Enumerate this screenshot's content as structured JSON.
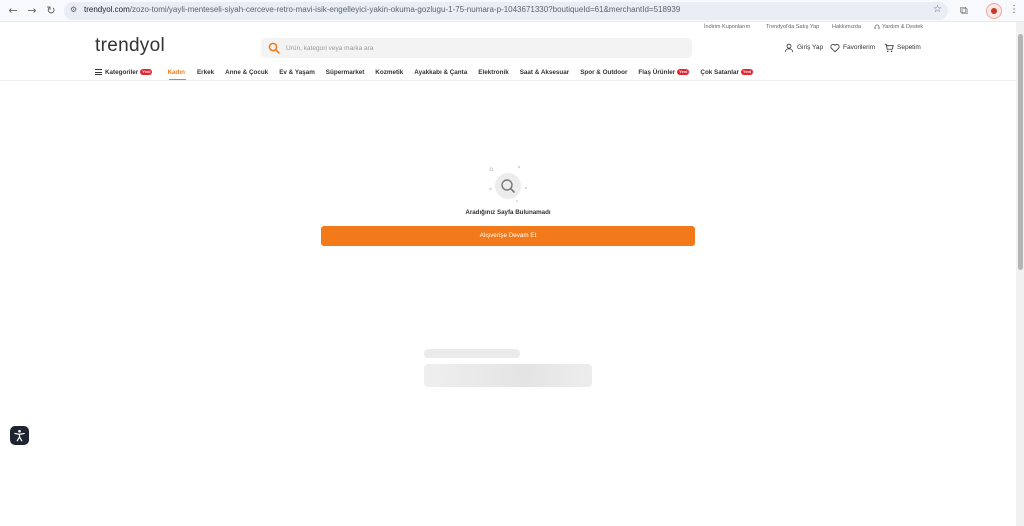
{
  "browser": {
    "url_host": "trendyol.com",
    "url_path": "/zozo-tomi/yayli-menteseli-siyah-cerceve-retro-mavi-isik-engelleyici-yakin-okuma-gozlugu-1-75-numara-p-1043671330?boutiqueId=61&merchantId=518939",
    "back_glyph": "←",
    "forward_glyph": "→",
    "reload_glyph": "↻",
    "tune_glyph": "⚙",
    "star_glyph": "☆",
    "extensions_glyph": "⧉",
    "menu_glyph": "⋮"
  },
  "top_links": {
    "discounted_coupons": "İndirim Kuponlarım",
    "sell_on_trendyol": "Trendyol'da Satış Yap",
    "about_us": "Hakkımızda",
    "help_support": "Yardım & Destek"
  },
  "header": {
    "logo": "trendyol",
    "search_placeholder": "Ürün, kategori veya marka ara",
    "login": "Giriş Yap",
    "favorites": "Favorilerim",
    "cart": "Sepetim",
    "accent_color": "#f27a1a"
  },
  "nav": {
    "categories": "Kategoriler",
    "badge_new": "Yeni",
    "items": [
      "Kadın",
      "Erkek",
      "Anne & Çocuk",
      "Ev & Yaşam",
      "Süpermarket",
      "Kozmetik",
      "Ayakkabı & Çanta",
      "Elektronik",
      "Saat & Aksesuar",
      "Spor & Outdoor",
      "Flaş Ürünler",
      "Çok Satanlar"
    ],
    "active_item": "Kadın"
  },
  "not_found": {
    "message": "Aradığınız Sayfa Bulunamadı",
    "button": "Alışverişe Devam Et"
  },
  "icons": {
    "search": "search-icon",
    "user": "user-icon",
    "heart": "heart-icon",
    "cart": "cart-icon",
    "headset": "headset-icon",
    "accessibility": "accessibility-icon",
    "magnifier_illustration": "magnifier-icon"
  }
}
